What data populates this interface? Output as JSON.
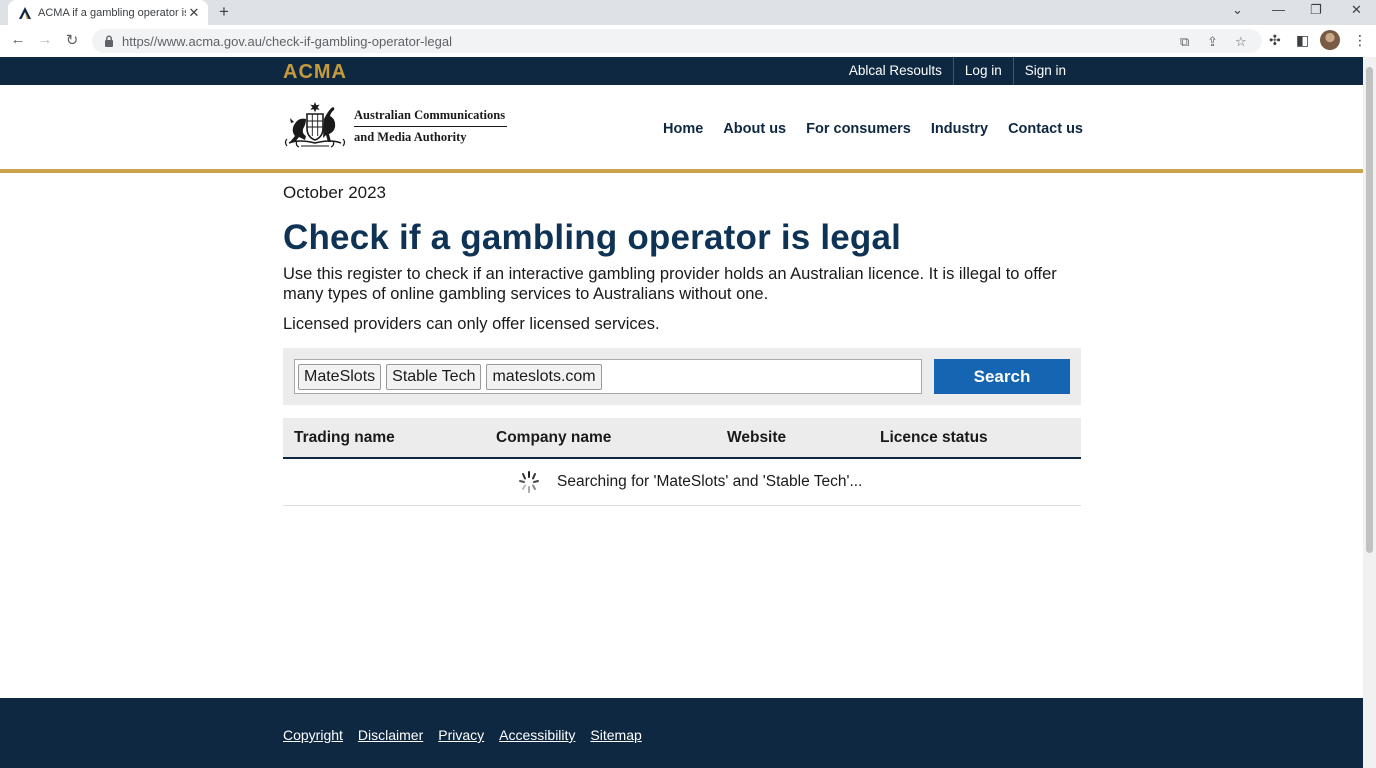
{
  "browser": {
    "tab_title": "ACMA if a gambling operator is",
    "new_tab": "+",
    "url": "https://www.acma.gov.au/check-if-gambling-operator-legal",
    "url_display": "https//www.acma.gov.au/check-if-gambling-operator-legal"
  },
  "utility_bar": {
    "logo": "ACMA",
    "links": [
      "Ablcal Resoults",
      "Log in",
      "Sign in"
    ]
  },
  "header": {
    "org_name_line1": "Australian Communications",
    "org_name_line2": "and Media Authority",
    "nav": [
      "Home",
      "About us",
      "For consumers",
      "Industry",
      "Contact us"
    ]
  },
  "content": {
    "date": "October 2023",
    "title": "Check if a gambling operator is legal",
    "intro": "Use this register to check if an interactive gambling provider holds an Australian licence. It is illegal to offer many types of online gambling services to Australians without one.",
    "intro2": "Licensed providers can only offer licensed services."
  },
  "search": {
    "chips": [
      "MateSlots",
      "Stable Tech",
      "mateslots.com"
    ],
    "button_label": "Search"
  },
  "results": {
    "columns": [
      "Trading name",
      "Company name",
      "Website",
      "Licence status"
    ],
    "loading_text": "Searching for 'MateSlots' and 'Stable Tech'..."
  },
  "footer": {
    "links": [
      "Copyright",
      "Disclaimer",
      "Privacy",
      "Accessibility",
      "Sitemap"
    ]
  },
  "colors": {
    "navy": "#0e2841",
    "gold": "#c9a44c",
    "heading_blue": "#0e3354",
    "button_blue": "#1565b2"
  }
}
